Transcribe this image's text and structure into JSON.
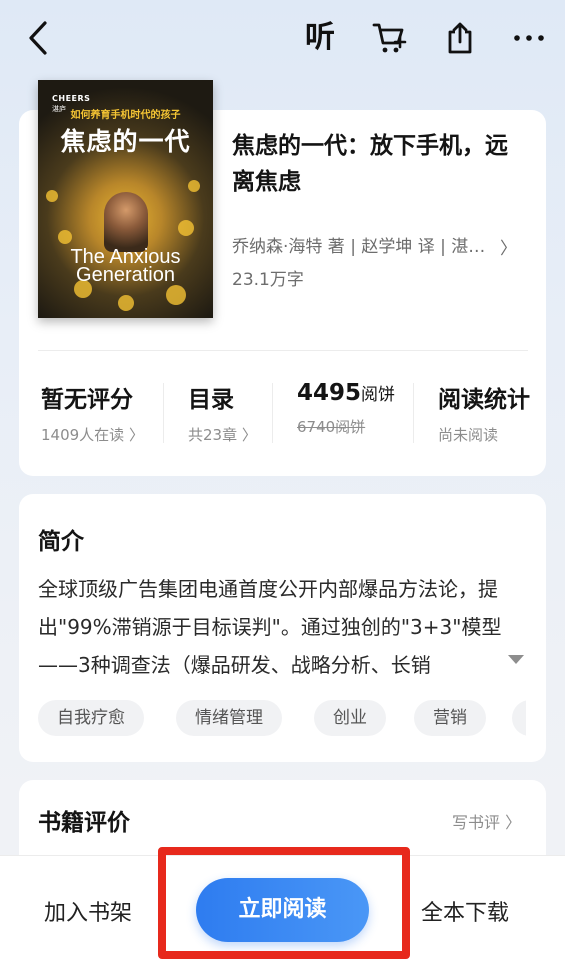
{
  "header": {
    "listen_label": "听",
    "icons": [
      "back-icon",
      "cart-add-icon",
      "share-icon",
      "more-icon"
    ]
  },
  "book": {
    "cover": {
      "publisher": "CHEERS",
      "publisher_cn": "湛庐",
      "tagline": "如何养育手机时代的孩子",
      "title_cn": "焦虑的一代",
      "title_en_line1": "The Anxious",
      "title_en_line2": "Generation"
    },
    "title": "焦虑的一代：放下手机，远离焦虑",
    "authors": "乔纳森·海特 著 | 赵学坤 译 | 湛…",
    "authors_more": "〉",
    "word_count": "23.1万字"
  },
  "stats": [
    {
      "big": "暂无评分",
      "small": "1409人在读 〉"
    },
    {
      "big": "目录",
      "small": "共23章 〉"
    },
    {
      "big_number": "4495",
      "big_unit": "阅饼",
      "small": "6740阅饼"
    },
    {
      "big": "阅读统计",
      "small": "尚未阅读"
    }
  ],
  "intro": {
    "title": "简介",
    "text": "全球顶级广告集团电通首度公开内部爆品方法论，提出\"99%滞销源于目标误判\"。通过独创的\"3+3\"模型——3种调查法（爆品研发、战略分析、长销",
    "tags": [
      "自我疗愈",
      "情绪管理",
      "创业",
      "营销"
    ]
  },
  "review": {
    "title": "书籍评价",
    "link": "写书评 〉"
  },
  "bottom": {
    "add_shelf": "加入书架",
    "read_now": "立即阅读",
    "download": "全本下载"
  },
  "colors": {
    "primary": "#2e7cf0",
    "highlight": "#e7291c"
  }
}
